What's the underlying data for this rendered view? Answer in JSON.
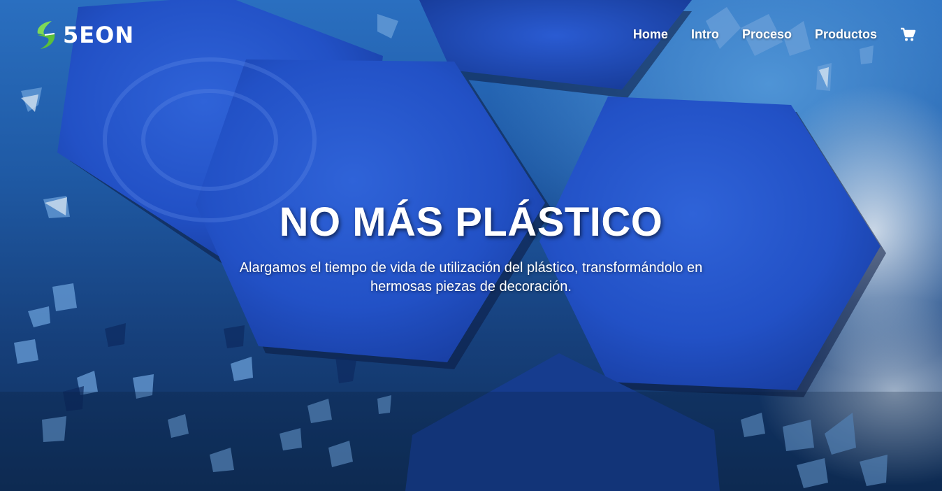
{
  "brand": {
    "logo_text": "5EON",
    "logo_icon": "leaf-s-logo-icon"
  },
  "nav": {
    "items": [
      "Home",
      "Intro",
      "Proceso",
      "Productos"
    ],
    "cart_icon": "shopping-cart-icon"
  },
  "hero": {
    "title": "NO MÁS PLÁSTICO",
    "subtitle": "Alargamos el tiempo de vida de utilización del plástico, transformándolo en hermosas piezas de decoración."
  },
  "colors": {
    "logo_green": "#7ed957",
    "hexagon_blue": "#1f4fc4",
    "background_blue": "#1f5aa5",
    "text": "#ffffff"
  }
}
